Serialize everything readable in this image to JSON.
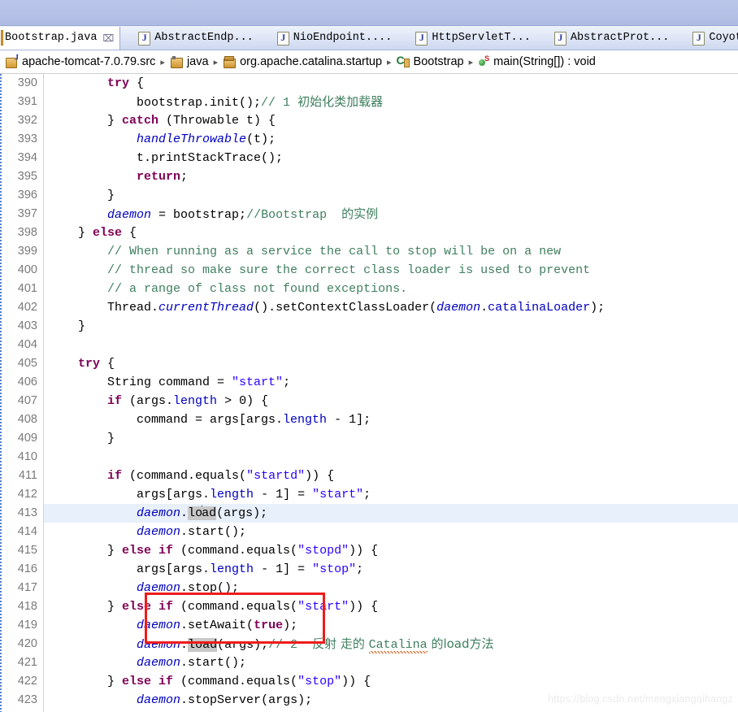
{
  "window": {
    "strip_color": "#b8c4e8"
  },
  "tabs": [
    {
      "label": "Bootstrap.java",
      "active": true,
      "close_glyph": "⌧",
      "icon": "java-file-icon"
    },
    {
      "label": "AbstractEndp...",
      "active": false,
      "icon": "java-file-icon"
    },
    {
      "label": "NioEndpoint....",
      "active": false,
      "icon": "java-file-icon"
    },
    {
      "label": "HttpServletT...",
      "active": false,
      "icon": "java-file-icon"
    },
    {
      "label": "AbstractProt...",
      "active": false,
      "icon": "java-file-icon"
    },
    {
      "label": "CoyoteAd",
      "active": false,
      "icon": "java-file-icon"
    }
  ],
  "breadcrumb": {
    "separator": "▸",
    "items": [
      {
        "label": "apache-tomcat-7.0.79.src",
        "icon": "java-project-icon"
      },
      {
        "label": "java",
        "icon": "source-folder-icon"
      },
      {
        "label": "org.apache.catalina.startup",
        "icon": "package-icon"
      },
      {
        "label": "Bootstrap",
        "icon": "class-icon"
      },
      {
        "label": "main(String[]) : void",
        "icon": "method-icon"
      }
    ]
  },
  "editor": {
    "first_line": 390,
    "highlighted_line": 413,
    "line_numbers": [
      390,
      391,
      392,
      393,
      394,
      395,
      396,
      397,
      398,
      399,
      400,
      401,
      402,
      403,
      404,
      405,
      406,
      407,
      408,
      409,
      410,
      411,
      412,
      413,
      414,
      415,
      416,
      417,
      418,
      419,
      420,
      421,
      422,
      423
    ],
    "lines_text": [
      "        try {",
      "            bootstrap.init();// 1 初始化类加载器",
      "        } catch (Throwable t) {",
      "            handleThrowable(t);",
      "            t.printStackTrace();",
      "            return;",
      "        }",
      "        daemon = bootstrap;//Bootstrap  的实例",
      "    } else {",
      "        // When running as a service the call to stop will be on a new",
      "        // thread so make sure the correct class loader is used to prevent",
      "        // a range of class not found exceptions.",
      "        Thread.currentThread().setContextClassLoader(daemon.catalinaLoader);",
      "    }",
      "",
      "    try {",
      "        String command = \"start\";",
      "        if (args.length > 0) {",
      "            command = args[args.length - 1];",
      "        }",
      "",
      "        if (command.equals(\"startd\")) {",
      "            args[args.length - 1] = \"start\";",
      "            daemon.load(args);",
      "            daemon.start();",
      "        } else if (command.equals(\"stopd\")) {",
      "            args[args.length - 1] = \"stop\";",
      "            daemon.stop();",
      "        } else if (command.equals(\"start\")) {",
      "            daemon.setAwait(true);",
      "            daemon.load(args);// 2  反射 走的 Catalina 的load方法",
      "            daemon.start();",
      "        } else if (command.equals(\"stop\")) {",
      "            daemon.stopServer(args);"
    ],
    "comments": {
      "line391": "// 1 初始化类加载器",
      "line397": "//Bootstrap  的实例",
      "line399": "// When running as a service the call to stop will be on a new",
      "line400": "// thread so make sure the correct class loader is used to prevent",
      "line401": "// a range of class not found exceptions.",
      "line420": "// 2  反射 走的 Catalina 的load方法"
    },
    "selection_text": "load",
    "annotation_box_color": "#ee1c1c"
  },
  "watermark": {
    "text": "https://blog.csdn.net/mengxiangqihangz"
  }
}
